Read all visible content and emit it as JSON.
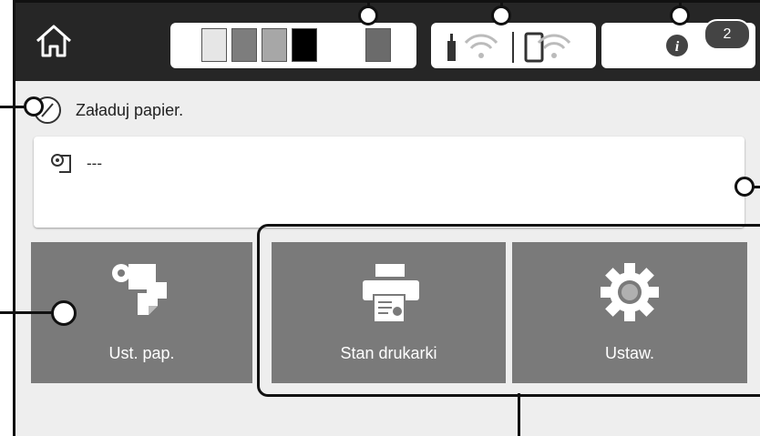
{
  "header": {
    "icons": [
      "home-icon",
      "ink-levels",
      "wifi-icon",
      "info-icon"
    ],
    "ink_colors": [
      "#e6e6e6",
      "#7d7d7d",
      "#a7a7a7",
      "#000000",
      "#ffffff",
      "#6b6b6b"
    ],
    "notification_count": "2"
  },
  "status": {
    "icon": "compass-icon",
    "message": "Załaduj papier."
  },
  "paper": {
    "icon": "paper-roll-icon",
    "value": "---"
  },
  "tiles": [
    {
      "label": "Ust. pap.",
      "icon": "paper-settings-icon"
    },
    {
      "label": "Stan drukarki",
      "icon": "printer-icon"
    },
    {
      "label": "Ustaw.",
      "icon": "gear-icon"
    }
  ],
  "colors": {
    "tile": "#7a7a7a",
    "topbar": "#262626",
    "screen": "#eeeeee"
  }
}
